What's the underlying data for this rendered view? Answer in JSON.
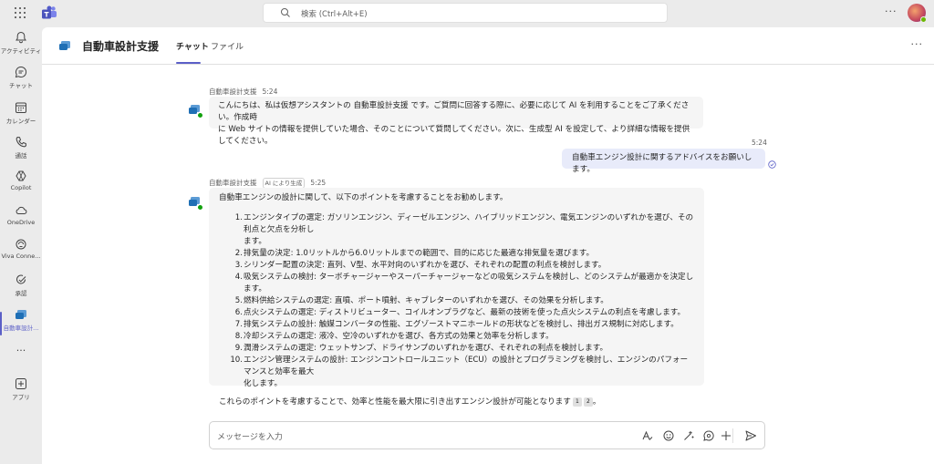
{
  "topbar": {
    "search_placeholder": "検索 (Ctrl+Alt+E)",
    "more": "···"
  },
  "rail": {
    "items": [
      {
        "label": "アクティビティ",
        "icon": "bell-icon"
      },
      {
        "label": "チャット",
        "icon": "chat-icon"
      },
      {
        "label": "カレンダー",
        "icon": "calendar-icon"
      },
      {
        "label": "通話",
        "icon": "phone-icon"
      },
      {
        "label": "Copilot",
        "icon": "copilot-icon"
      },
      {
        "label": "OneDrive",
        "icon": "cloud-icon"
      },
      {
        "label": "Viva Conne...",
        "icon": "viva-icon"
      },
      {
        "label": "承認",
        "icon": "approval-icon"
      },
      {
        "label": "自動車設計...",
        "icon": "app-icon"
      },
      {
        "label": "···",
        "icon": "more-icon"
      },
      {
        "label": "アプリ",
        "icon": "add-app-icon"
      }
    ]
  },
  "header": {
    "title": "自動車設計支援",
    "tabs": [
      {
        "label": "チャット",
        "active": true
      },
      {
        "label": "ファイル",
        "active": false
      }
    ],
    "more": "···"
  },
  "messages": {
    "intro": {
      "sender": "自動車設計支援",
      "time": "5:24",
      "text_line1": "こんにちは、私は仮想アシスタントの 自動車設計支援 です。ご質問に回答する際に、必要に応じて AI を利用することをご了承ください。作成時",
      "text_line2": "に Web サイトの情報を提供していた場合、そのことについて質問してください。次に、生成型 AI を設定して、より詳細な情報を提供してください。"
    },
    "user": {
      "time": "5:24",
      "text": "自動車エンジン設計に関するアドバイスをお願いします。"
    },
    "answer": {
      "sender": "自動車設計支援",
      "badge": "AI により生成",
      "time": "5:25",
      "intro": "自動車エンジンの設計に関して、以下のポイントを考慮することをお勧めします。",
      "points": [
        {
          "num": "1.",
          "line1": "エンジンタイプの選定: ガソリンエンジン、ディーゼルエンジン、ハイブリッドエンジン、電気エンジンのいずれかを選び、その利点と欠点を分析し",
          "line2": "ます。"
        },
        {
          "num": "2.",
          "line1": "排気量の決定: 1.0リットルから6.0リットルまでの範囲で、目的に応じた最適な排気量を選びます。",
          "line2": ""
        },
        {
          "num": "3.",
          "line1": "シリンダー配置の決定: 直列、V型、水平対向のいずれかを選び、それぞれの配置の利点を検討します。",
          "line2": ""
        },
        {
          "num": "4.",
          "line1": "吸気システムの検討: ターボチャージャーやスーパーチャージャーなどの吸気システムを検討し、どのシステムが最適かを決定します。",
          "line2": ""
        },
        {
          "num": "5.",
          "line1": "燃料供給システムの選定: 直噴、ポート噴射、キャブレターのいずれかを選び、その効果を分析します。",
          "line2": ""
        },
        {
          "num": "6.",
          "line1": "点火システムの選定: ディストリビューター、コイルオンプラグなど、最新の技術を使った点火システムの利点を考慮します。",
          "line2": ""
        },
        {
          "num": "7.",
          "line1": "排気システムの設計: 触媒コンバータの性能、エグゾーストマニホールドの形状などを検討し、排出ガス規制に対応します。",
          "line2": ""
        },
        {
          "num": "8.",
          "line1": "冷却システムの選定: 液冷、空冷のいずれかを選び、各方式の効果と効率を分析します。",
          "line2": ""
        },
        {
          "num": "9.",
          "line1": "潤滑システムの選定: ウェットサンプ、ドライサンプのいずれかを選び、それぞれの利点を検討します。",
          "line2": ""
        },
        {
          "num": "10.",
          "line1": "エンジン管理システムの設計: エンジンコントロールユニット（ECU）の設計とプログラミングを検討し、エンジンのパフォーマンスと効率を最大",
          "line2": "化します。"
        }
      ],
      "conclusion": "これらのポイントを考慮することで、効率と性能を最大限に引き出すエンジン設計が可能となります",
      "citations": [
        "1",
        "2"
      ],
      "end_mark": "。"
    }
  },
  "compose": {
    "placeholder": "メッセージを入力"
  }
}
